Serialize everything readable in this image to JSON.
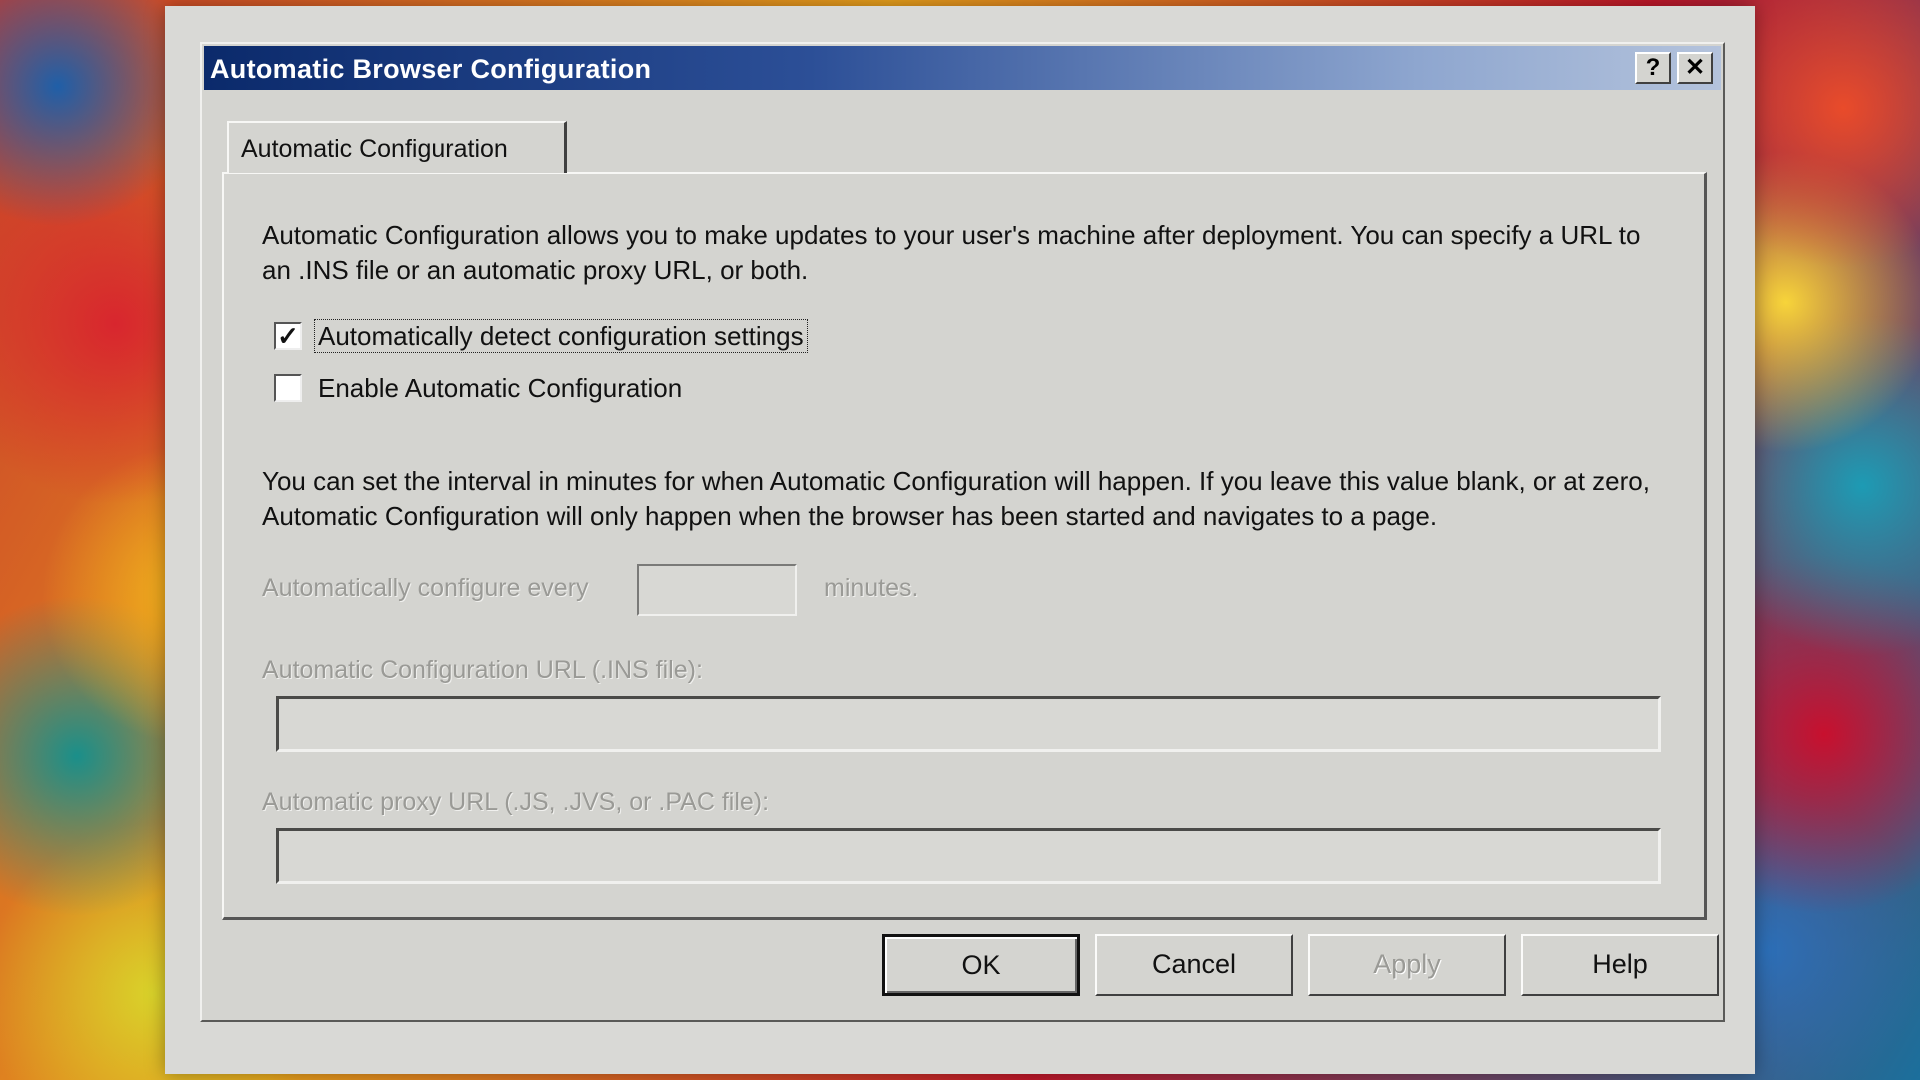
{
  "window": {
    "title": "Automatic Browser Configuration",
    "help_glyph": "?",
    "close_glyph": "✕"
  },
  "tab": {
    "label": "Automatic Configuration"
  },
  "content": {
    "intro_text": "Automatic Configuration allows you to make updates to your user's machine after deployment. You can specify a URL to an .INS file or an automatic proxy URL, or both.",
    "auto_detect": {
      "label": "Automatically detect configuration settings",
      "checked": true,
      "mark": "✓"
    },
    "enable_auto_config": {
      "label": "Enable Automatic Configuration",
      "checked": false,
      "mark": ""
    },
    "interval_text": "You can set the interval in minutes for when Automatic Configuration will happen. If you leave this value blank, or at zero, Automatic Configuration will only happen when the browser has been started and navigates to a page.",
    "interval_label": "Automatically configure every",
    "interval_value": "",
    "minutes_label": "minutes.",
    "config_url_label": "Automatic Configuration URL (.INS file):",
    "config_url_value": "",
    "proxy_url_label": "Automatic proxy URL (.JS, .JVS, or .PAC file):",
    "proxy_url_value": ""
  },
  "buttons": {
    "ok": "OK",
    "cancel": "Cancel",
    "apply": "Apply",
    "help": "Help"
  }
}
